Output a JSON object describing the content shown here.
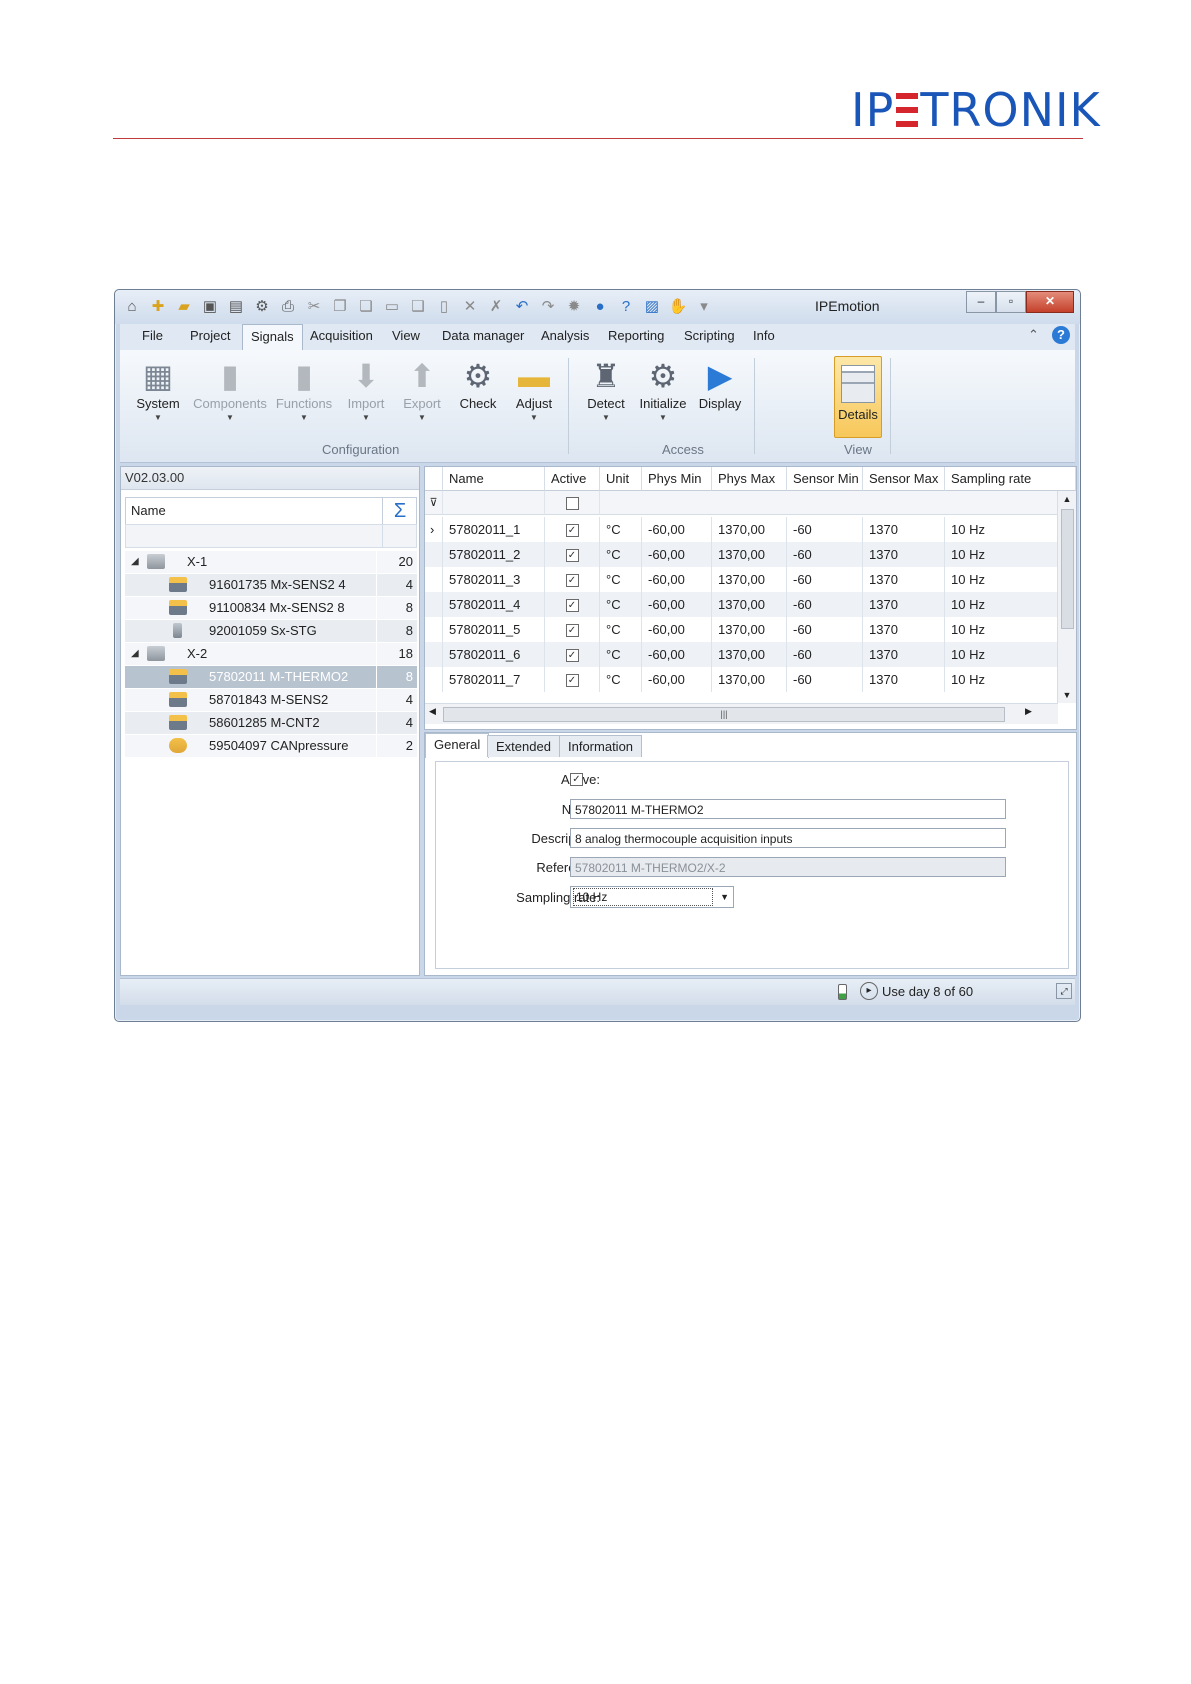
{
  "brand": {
    "logo_left": "IP",
    "logo_right": "TRONIK"
  },
  "window": {
    "title": "IPEmotion"
  },
  "menu": [
    "File",
    "Project",
    "Signals",
    "Acquisition",
    "View",
    "Data manager",
    "Analysis",
    "Reporting",
    "Scripting",
    "Info"
  ],
  "ribbon": {
    "system": "System",
    "components": "Components",
    "functions": "Functions",
    "import": "Import",
    "export": "Export",
    "check": "Check",
    "adjust": "Adjust",
    "detect": "Detect",
    "initialize": "Initialize",
    "display": "Display",
    "details": "Details",
    "group_configuration": "Configuration",
    "group_access": "Access",
    "group_view": "View"
  },
  "tree": {
    "version": "V02.03.00",
    "col_name": "Name",
    "rows": [
      {
        "label": "X-1",
        "count": "20"
      },
      {
        "label": "91601735 Mx-SENS2 4",
        "count": "4"
      },
      {
        "label": "91100834 Mx-SENS2 8",
        "count": "8"
      },
      {
        "label": "92001059 Sx-STG",
        "count": "8"
      },
      {
        "label": "X-2",
        "count": "18"
      },
      {
        "label": "57802011 M-THERMO2",
        "count": "8"
      },
      {
        "label": "58701843 M-SENS2",
        "count": "4"
      },
      {
        "label": "58601285 M-CNT2",
        "count": "4"
      },
      {
        "label": "59504097 CANpressure",
        "count": "2"
      }
    ]
  },
  "grid": {
    "columns": [
      "Name",
      "Active",
      "Unit",
      "Phys Min",
      "Phys Max",
      "Sensor Min",
      "Sensor Max",
      "Sampling rate"
    ],
    "rows": [
      [
        "57802011_1",
        "✓",
        "°C",
        "-60,00",
        "1370,00",
        "-60",
        "1370",
        "10 Hz"
      ],
      [
        "57802011_2",
        "✓",
        "°C",
        "-60,00",
        "1370,00",
        "-60",
        "1370",
        "10 Hz"
      ],
      [
        "57802011_3",
        "✓",
        "°C",
        "-60,00",
        "1370,00",
        "-60",
        "1370",
        "10 Hz"
      ],
      [
        "57802011_4",
        "✓",
        "°C",
        "-60,00",
        "1370,00",
        "-60",
        "1370",
        "10 Hz"
      ],
      [
        "57802011_5",
        "✓",
        "°C",
        "-60,00",
        "1370,00",
        "-60",
        "1370",
        "10 Hz"
      ],
      [
        "57802011_6",
        "✓",
        "°C",
        "-60,00",
        "1370,00",
        "-60",
        "1370",
        "10 Hz"
      ],
      [
        "57802011_7",
        "✓",
        "°C",
        "-60,00",
        "1370,00",
        "-60",
        "1370",
        "10 Hz"
      ]
    ]
  },
  "details": {
    "tabs": [
      "General",
      "Extended",
      "Information"
    ],
    "active_label": "Active:",
    "name_label": "Name:",
    "name_value": "57802011 M-THERMO2",
    "description_label": "Description:",
    "description_value": "8 analog thermocouple acquisition inputs",
    "reference_label": "Reference:",
    "reference_value": "57802011 M-THERMO2/X-2",
    "sampling_label": "Sampling rate:",
    "sampling_value": "10 Hz"
  },
  "status": {
    "license": "Use day 8 of 60"
  }
}
